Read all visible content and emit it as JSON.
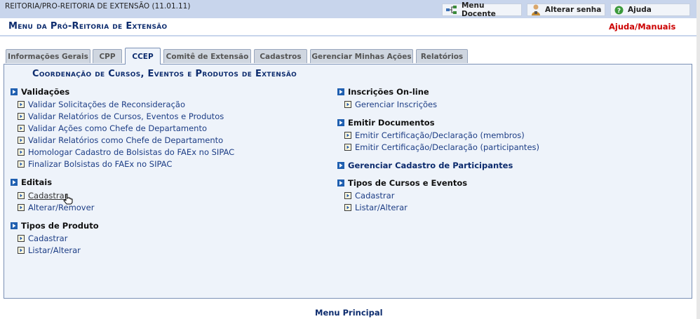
{
  "topbar": {
    "unit": "REITORIA/PRO-REITORIA DE EXTENSÃO (11.01.11)",
    "buttons": [
      "Menu Docente",
      "Alterar senha",
      "Ajuda"
    ]
  },
  "header": {
    "title": "Menu da Pró-Reitoria de Extensão",
    "help": "Ajuda/Manuais"
  },
  "tabs": [
    {
      "label": "Informações Gerais",
      "active": false
    },
    {
      "label": "CPP",
      "active": false
    },
    {
      "label": "CCEP",
      "active": true
    },
    {
      "label": "Comitê de Extensão",
      "active": false
    },
    {
      "label": "Cadastros",
      "active": false
    },
    {
      "label": "Gerenciar Minhas Ações",
      "active": false
    },
    {
      "label": "Relatórios",
      "active": false
    }
  ],
  "panel": {
    "title": "Coordenação de Cursos, Eventos e Produtos de Extensão",
    "left": [
      {
        "heading": "Validações",
        "items": [
          "Validar Solicitações de Reconsideração",
          "Validar Relatórios de Cursos, Eventos e Produtos",
          "Validar Ações como Chefe de Departamento",
          "Validar Relatórios como Chefe de Departamento",
          "Homologar Cadastro de Bolsistas do FAEx no SIPAC",
          "Finalizar Bolsistas do FAEx no SIPAC"
        ]
      },
      {
        "heading": "Editais",
        "items": [
          "Cadastrar",
          "Alterar/Remover"
        ]
      },
      {
        "heading": "Tipos de Produto",
        "items": [
          "Cadastrar",
          "Listar/Alterar"
        ]
      }
    ],
    "right": [
      {
        "heading": "Inscrições On-line",
        "items": [
          "Gerenciar Inscrições"
        ]
      },
      {
        "heading": "Emitir Documentos",
        "items": [
          "Emitir Certificação/Declaração (membros)",
          "Emitir Certificação/Declaração (participantes)"
        ]
      },
      {
        "heading": "Gerenciar Cadastro de Participantes",
        "items": []
      },
      {
        "heading": "Tipos de Cursos e Eventos",
        "items": [
          "Cadastrar",
          "Listar/Alterar"
        ]
      }
    ]
  },
  "footer": {
    "main_menu": "Menu Principal"
  },
  "colors": {
    "accent": "#0d2c6e",
    "help": "#cc0000",
    "panel_bg": "#eef3fa",
    "topbar_bg": "#c8d5ec"
  }
}
